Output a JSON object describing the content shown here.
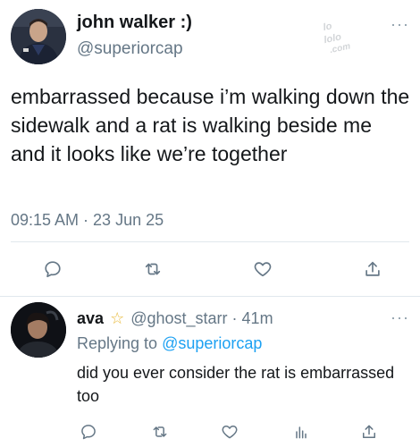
{
  "tweet": {
    "author_name": "john walker :)",
    "author_handle": "@superiorcap",
    "text": "embarrassed because i’m walking down the sidewalk and a rat is walking beside me and it looks like we’re  together",
    "timestamp": "09:15 AM · 23 Jun 25",
    "more_label": "···",
    "actions": [
      "reply-icon",
      "retweet-icon",
      "like-icon",
      "share-icon"
    ]
  },
  "reply": {
    "author_name": "ava",
    "badge": "☆",
    "author_handle": "@ghost_starr",
    "separator": " · ",
    "time": "41m",
    "replying_prefix": "Replying to ",
    "replying_to": "@superiorcap",
    "text": "did you ever consider the rat is embarrassed too",
    "more_label": "···",
    "actions": [
      "reply-icon",
      "retweet-icon",
      "like-icon",
      "analytics-icon",
      "share-icon"
    ]
  },
  "colors": {
    "text": "#14171a",
    "muted": "#657786",
    "link": "#1da1f2",
    "divider": "#e1e8ed"
  }
}
